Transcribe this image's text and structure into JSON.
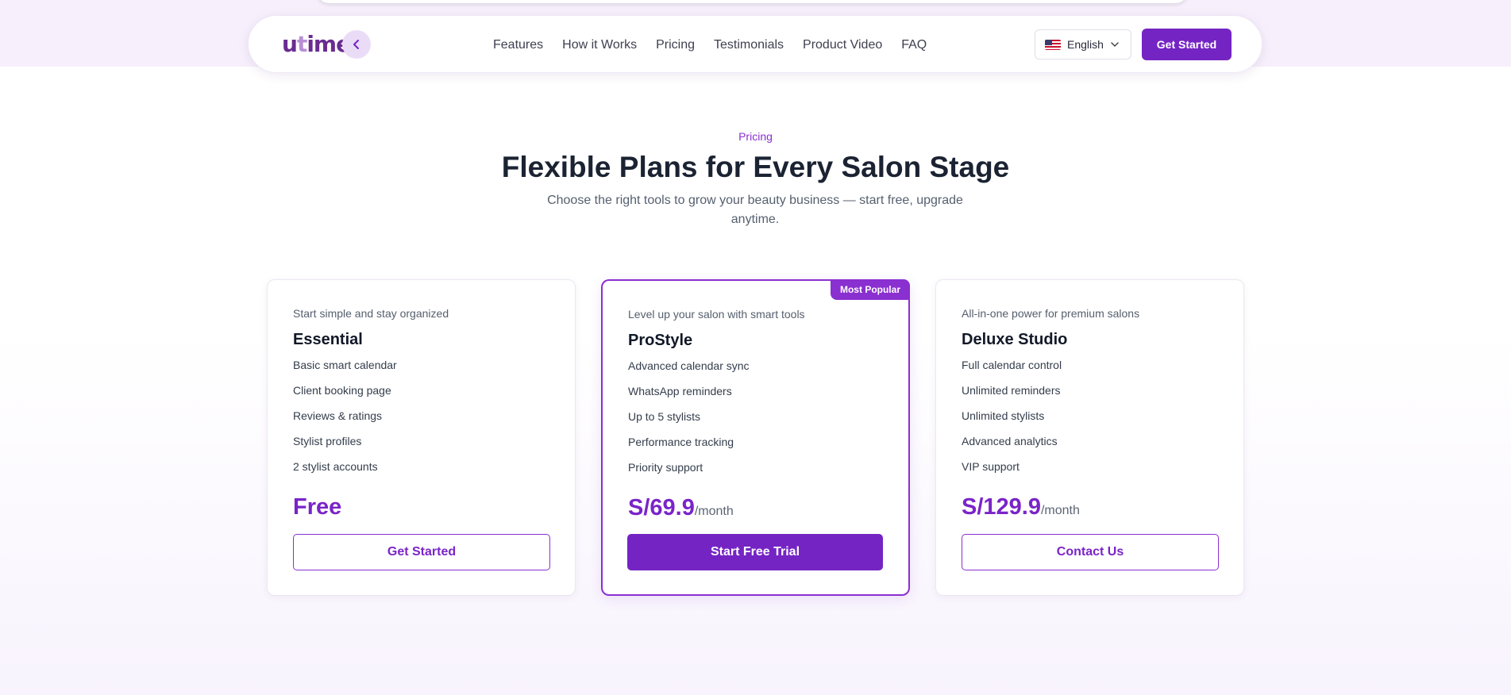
{
  "brand": {
    "logo_prefix": "u",
    "logo_t": "t",
    "logo_suffix": "ime",
    "accent": "#7524c4"
  },
  "nav": {
    "links": [
      "Features",
      "How it Works",
      "Pricing",
      "Testimonials",
      "Product Video",
      "FAQ"
    ],
    "language": "English",
    "language_icon": "us-flag-icon",
    "cta": "Get Started"
  },
  "pricing": {
    "eyebrow": "Pricing",
    "title": "Flexible Plans for Every Salon Stage",
    "subtitle": "Choose the right tools to grow your beauty business — start free, upgrade anytime.",
    "plans": [
      {
        "tagline": "Start simple and stay organized",
        "name": "Essential",
        "features": [
          "Basic smart calendar",
          "Client booking page",
          "Reviews & ratings",
          "Stylist profiles",
          "2 stylist accounts"
        ],
        "price": "Free",
        "period": "",
        "button": "Get Started"
      },
      {
        "badge": "Most Popular",
        "tagline": "Level up your salon with smart tools",
        "name": "ProStyle",
        "features": [
          "Advanced calendar sync",
          "WhatsApp reminders",
          "Up to 5 stylists",
          "Performance tracking",
          "Priority support"
        ],
        "price": "S/69.9",
        "period": "/month",
        "button": "Start Free Trial"
      },
      {
        "tagline": "All-in-one power for premium salons",
        "name": "Deluxe Studio",
        "features": [
          "Full calendar control",
          "Unlimited reminders",
          "Unlimited stylists",
          "Advanced analytics",
          "VIP support"
        ],
        "price": "S/129.9",
        "period": "/month",
        "button": "Contact Us"
      }
    ]
  }
}
